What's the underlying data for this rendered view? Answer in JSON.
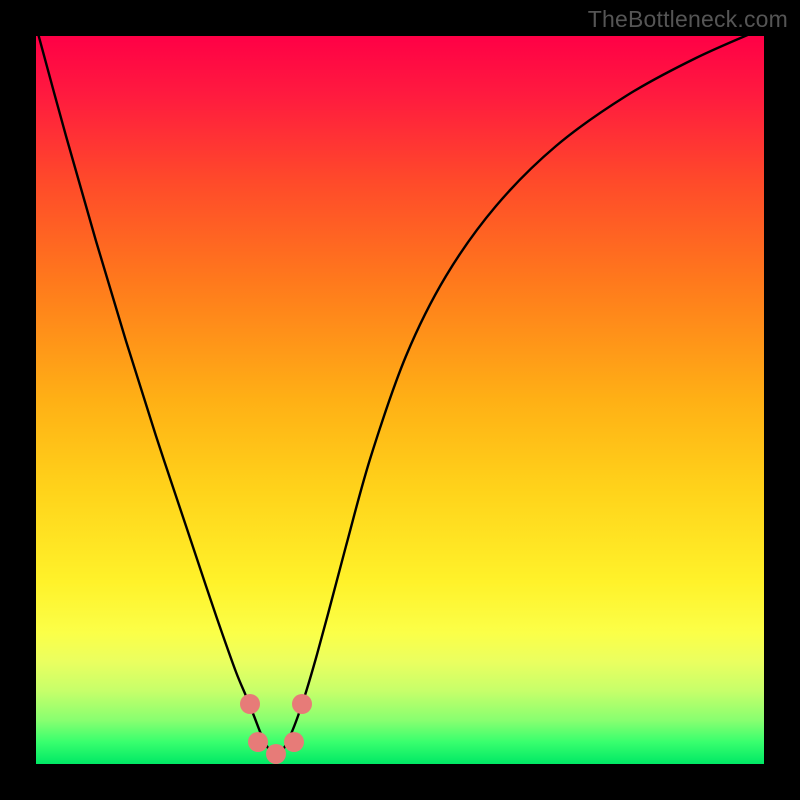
{
  "watermark": "TheBottleneck.com",
  "chart_data": {
    "type": "line",
    "title": "",
    "xlabel": "",
    "ylabel": "",
    "xlim": [
      0,
      728
    ],
    "ylim": [
      -10,
      728
    ],
    "series": [
      {
        "name": "bottleneck-curve",
        "x": [
          0,
          30,
          60,
          90,
          120,
          150,
          170,
          185,
          200,
          210,
          218,
          225,
          232,
          240,
          248,
          255,
          262,
          270,
          280,
          292,
          310,
          335,
          370,
          410,
          460,
          520,
          590,
          660,
          728
        ],
        "y": [
          -10,
          100,
          205,
          305,
          400,
          490,
          550,
          594,
          636,
          660,
          680,
          698,
          712,
          720,
          712,
          698,
          680,
          656,
          622,
          578,
          510,
          420,
          320,
          240,
          170,
          110,
          60,
          22,
          -8
        ]
      }
    ],
    "markers": [
      {
        "name": "left-dot-upper",
        "x": 214,
        "y": 668,
        "r": 10
      },
      {
        "name": "left-dot-lower",
        "x": 222,
        "y": 706,
        "r": 10
      },
      {
        "name": "mid-dot",
        "x": 240,
        "y": 718,
        "r": 10
      },
      {
        "name": "right-dot-lower",
        "x": 258,
        "y": 706,
        "r": 10
      },
      {
        "name": "right-dot-upper",
        "x": 266,
        "y": 668,
        "r": 10
      }
    ],
    "marker_color": "#e77b78",
    "curve_color": "#000000",
    "curve_width": 2.4
  }
}
